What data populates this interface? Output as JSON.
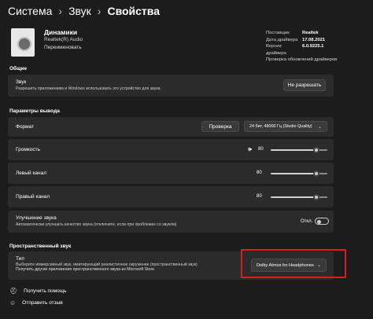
{
  "breadcrumb": {
    "items": [
      "Система",
      "Звук",
      "Свойства"
    ],
    "separator": "›"
  },
  "device": {
    "name": "Динамики",
    "driver": "Realtek(R) Audio",
    "rename": "Переименовать"
  },
  "properties": {
    "rows": [
      {
        "key": "Поставщик",
        "value": "Realtek"
      },
      {
        "key": "Дата драйвера",
        "value": "17.08.2021"
      },
      {
        "key": "Версия драйвера",
        "value": "6.0.9225.1"
      }
    ],
    "update_link": "Проверка обновлений драйверов"
  },
  "general": {
    "section_title": "Общие",
    "audio_label": "Звук",
    "audio_desc": "Разрешить приложениям и Windows использовать это устройство для звука",
    "disallow_button": "Не разрешать"
  },
  "output": {
    "section_title": "Параметры вывода",
    "format_label": "Формат",
    "test_button": "Проверка",
    "format_value": "24 бит, 48000 Гц (Studio Quality)",
    "volume_label": "Громкость",
    "volume_value": "80",
    "left_label": "Левый канал",
    "left_value": "80",
    "right_label": "Правый канал",
    "right_value": "80",
    "enhance_label": "Улучшение звука",
    "enhance_desc": "Автоматически улучшать качество звука (отключите, если при проблемах со звуком)",
    "enhance_state": "Откл.",
    "slider_level": 0.8
  },
  "spatial": {
    "section_title": "Пространственный звук",
    "type_label": "Тип",
    "type_desc1": "Выберите иммерсивный звук, имитирующий реалистичное окружение (пространственный звук)",
    "type_desc2": "Получить другие приложения пространственного звука из Microsoft Store",
    "type_value": "Dolby Atmos for Headphones"
  },
  "footer": {
    "help": "Получить помощь",
    "feedback": "Отправить отзыв"
  },
  "colors": {
    "background": "#1c1c1c",
    "card": "#2b2b2b",
    "highlight": "#d81e1e"
  }
}
